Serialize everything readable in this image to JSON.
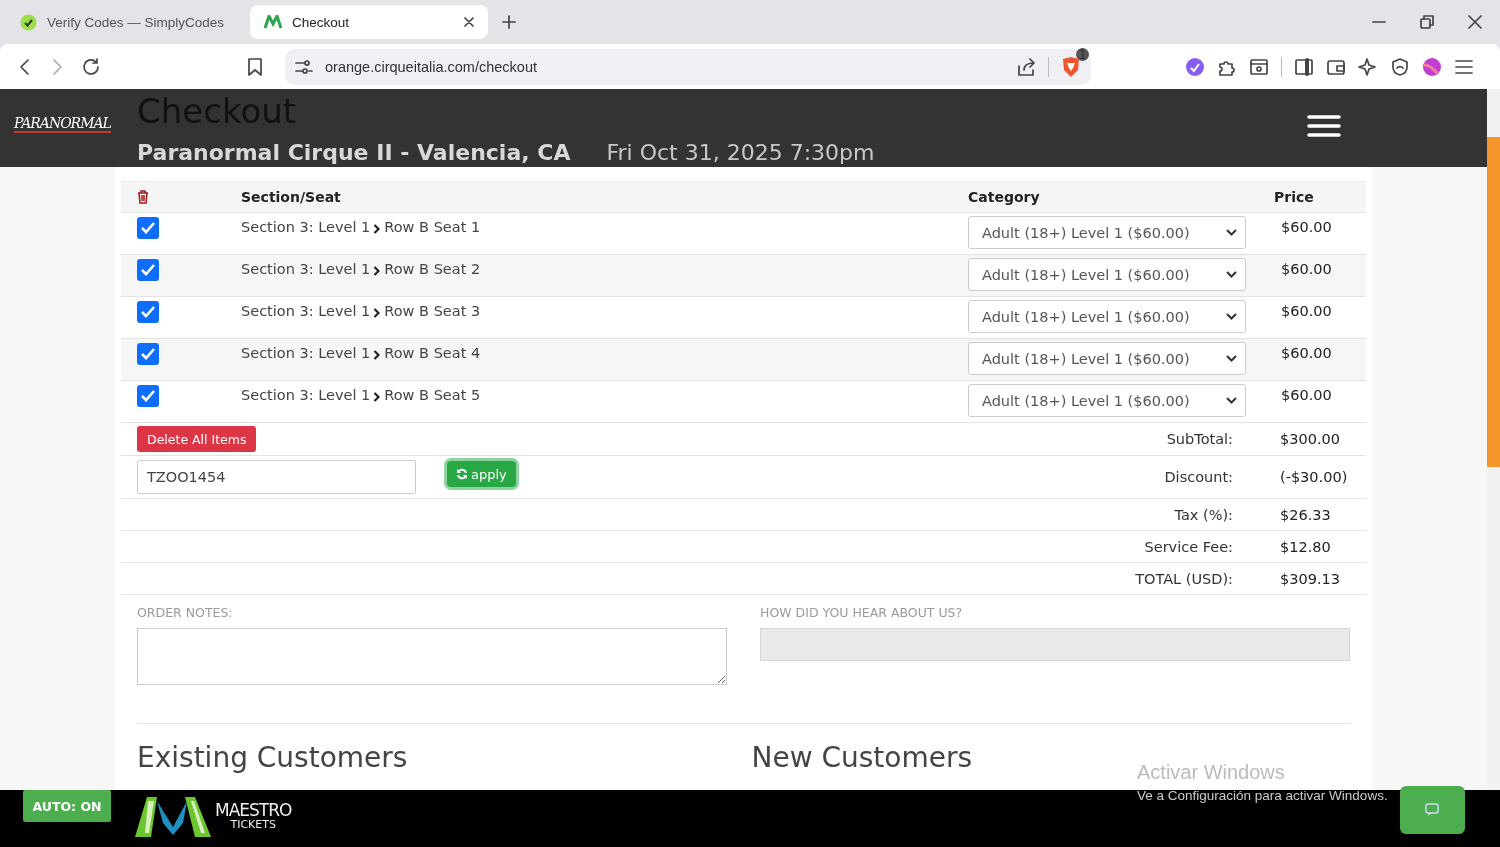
{
  "browser": {
    "tabs": [
      {
        "title": "Verify Codes — SimplyCodes",
        "selected": false
      },
      {
        "title": "Checkout",
        "selected": true
      }
    ],
    "url": "orange.cirqueitalia.com/checkout",
    "shield_badge": "1"
  },
  "header": {
    "logo_text": "PARANORMAL"
  },
  "page": {
    "title": "Checkout",
    "event": "Paranormal Cirque II - Valencia, CA",
    "date": "Fri Oct 31, 2025 7:30pm"
  },
  "table": {
    "columns": [
      "Section/Seat",
      "Category",
      "Price"
    ],
    "rows": [
      {
        "checked": true,
        "section": "Section 3: Level 1",
        "seat": "Row B Seat 1",
        "category": "Adult (18+) Level 1 ($60.00)",
        "price": "$60.00"
      },
      {
        "checked": true,
        "section": "Section 3: Level 1",
        "seat": "Row B Seat 2",
        "category": "Adult (18+) Level 1 ($60.00)",
        "price": "$60.00"
      },
      {
        "checked": true,
        "section": "Section 3: Level 1",
        "seat": "Row B Seat 3",
        "category": "Adult (18+) Level 1 ($60.00)",
        "price": "$60.00"
      },
      {
        "checked": true,
        "section": "Section 3: Level 1",
        "seat": "Row B Seat 4",
        "category": "Adult (18+) Level 1 ($60.00)",
        "price": "$60.00"
      },
      {
        "checked": true,
        "section": "Section 3: Level 1",
        "seat": "Row B Seat 5",
        "category": "Adult (18+) Level 1 ($60.00)",
        "price": "$60.00"
      }
    ]
  },
  "delete_button": "Delete All Items",
  "coupon": {
    "value": "TZOO1454",
    "button": "apply"
  },
  "totals": [
    {
      "label": "SubTotal:",
      "value": "$300.00"
    },
    {
      "label": "Discount:",
      "value": "(-$30.00)"
    },
    {
      "label": "Tax (%):",
      "value": "$26.33"
    },
    {
      "label": "Service Fee:",
      "value": "$12.80"
    },
    {
      "label": "TOTAL (USD):",
      "value": "$309.13"
    }
  ],
  "notes": {
    "order_notes_label": "ORDER NOTES:",
    "hear_label": "HOW DID YOU HEAR ABOUT US?"
  },
  "sections": [
    "Existing Customers",
    "New Customers"
  ],
  "footer": {
    "auto_button": "AUTO: ON",
    "logo_top": "MAESTRO",
    "logo_bottom": "TICKETS"
  },
  "os_notice": {
    "title": "Activar Windows",
    "text": "Ve a Configuración para activar Windows."
  }
}
